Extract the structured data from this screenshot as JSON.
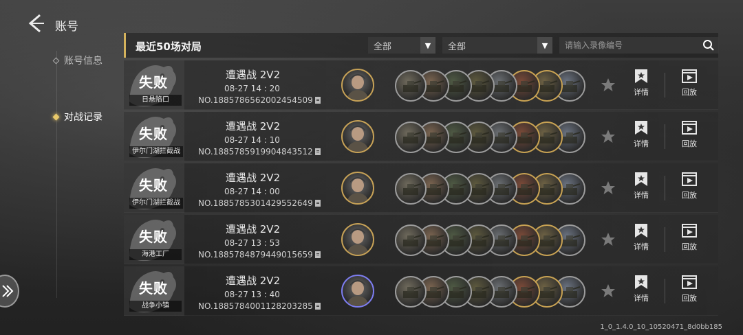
{
  "header": {
    "title": "账号"
  },
  "nav": {
    "items": [
      {
        "label": "账号信息"
      },
      {
        "label": "对战记录"
      }
    ]
  },
  "toolbar": {
    "section_title": "最近50场对局",
    "filter1": "全部",
    "filter2": "全部",
    "search_placeholder": "请输入录像编号"
  },
  "matches": [
    {
      "result": "失败",
      "map": "日悬陷口",
      "mode": "遭遇战 2V2",
      "time": "08-27  14 : 20",
      "replay_no": "NO.1885786562002454509",
      "detail": "详情",
      "replay": "回放"
    },
    {
      "result": "失败",
      "map": "伊尔门湖拦截战",
      "mode": "遭遇战 2V2",
      "time": "08-27  14 : 10",
      "replay_no": "NO.1885785919904843512",
      "detail": "详情",
      "replay": "回放"
    },
    {
      "result": "失败",
      "map": "伊尔门湖拦截战",
      "mode": "遭遇战 2V2",
      "time": "08-27  14 : 00",
      "replay_no": "NO.1885785301429552649",
      "detail": "详情",
      "replay": "回放"
    },
    {
      "result": "失败",
      "map": "海港工厂",
      "mode": "遭遇战 2V2",
      "time": "08-27  13 : 53",
      "replay_no": "NO.1885784879449015659",
      "detail": "详情",
      "replay": "回放"
    },
    {
      "result": "失败",
      "map": "战争小镇",
      "mode": "遭遇战 2V2",
      "time": "08-27  13 : 40",
      "replay_no": "NO.1885784001128203285",
      "detail": "详情",
      "replay": "回放"
    }
  ],
  "version": "1_0_1.4.0_10_10520471_8d0bb185"
}
